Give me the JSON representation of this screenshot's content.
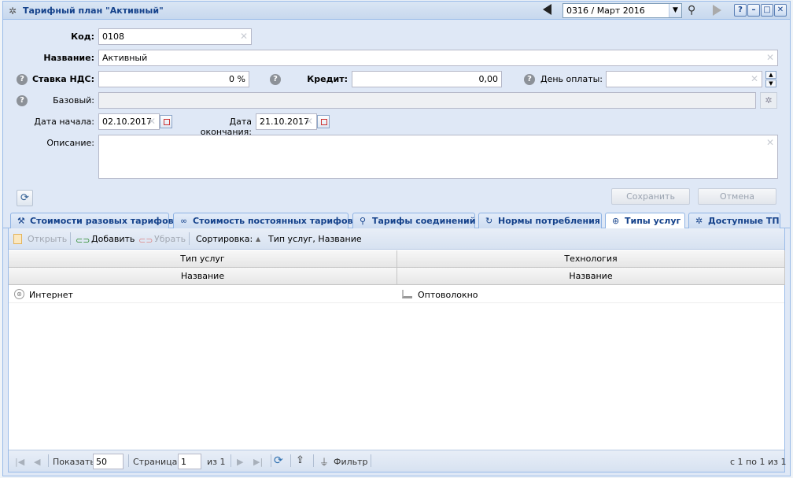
{
  "window": {
    "title": "Тарифный план \"Активный\"",
    "period": "0316 / Март 2016",
    "icons": {
      "period_prev": "triangle-left-icon",
      "period_next": "triangle-right-icon",
      "search": "magnifier-icon"
    },
    "buttons": {
      "help": "?",
      "minimize": "–",
      "maximize": "□",
      "close": "✕"
    }
  },
  "form": {
    "code_label": "Код:",
    "code_value": "0108",
    "name_label": "Название:",
    "name_value": "Активный",
    "vat_label": "Ставка НДС:",
    "vat_value": "0 %",
    "credit_label": "Кредит:",
    "credit_value": "0,00",
    "payday_label": "День оплаты:",
    "payday_value": "",
    "base_label": "Базовый:",
    "base_value": "",
    "start_label": "Дата начала:",
    "start_value": "02.10.2017",
    "end_label": "Дата окончания:",
    "end_value": "21.10.2017",
    "desc_label": "Описание:",
    "desc_value": "",
    "save_label": "Сохранить",
    "cancel_label": "Отмена"
  },
  "tabs": [
    {
      "label": "Стоимости разовых тарифов",
      "icon": "wrench-icon",
      "active": false
    },
    {
      "label": "Стоимость постоянных тарифов",
      "icon": "link-icon",
      "active": false
    },
    {
      "label": "Тарифы соединений",
      "icon": "connections-icon",
      "active": false
    },
    {
      "label": "Нормы потребления",
      "icon": "gauge-icon",
      "active": false
    },
    {
      "label": "Типы услуг",
      "icon": "service-icon",
      "active": true
    },
    {
      "label": "Доступные ТП",
      "icon": "tariff-icon",
      "active": false
    }
  ],
  "grid": {
    "toolbar": {
      "open": "Открыть",
      "add": "Добавить",
      "remove": "Убрать",
      "sort_label": "Сортировка:",
      "sort_value": "Тип услуг, Название"
    },
    "group_headers": [
      "Тип услуг",
      "Технология"
    ],
    "column_headers": [
      "Название",
      "Название"
    ],
    "rows": [
      {
        "service": "Интернет",
        "technology": "Оптоволокно"
      }
    ]
  },
  "pager": {
    "show_label": "Показать",
    "page_size": "50",
    "page_label": "Страница",
    "page": "1",
    "of_label": "из 1",
    "filter_label": "Фильтр",
    "summary": "с 1 по 1 из 1"
  }
}
